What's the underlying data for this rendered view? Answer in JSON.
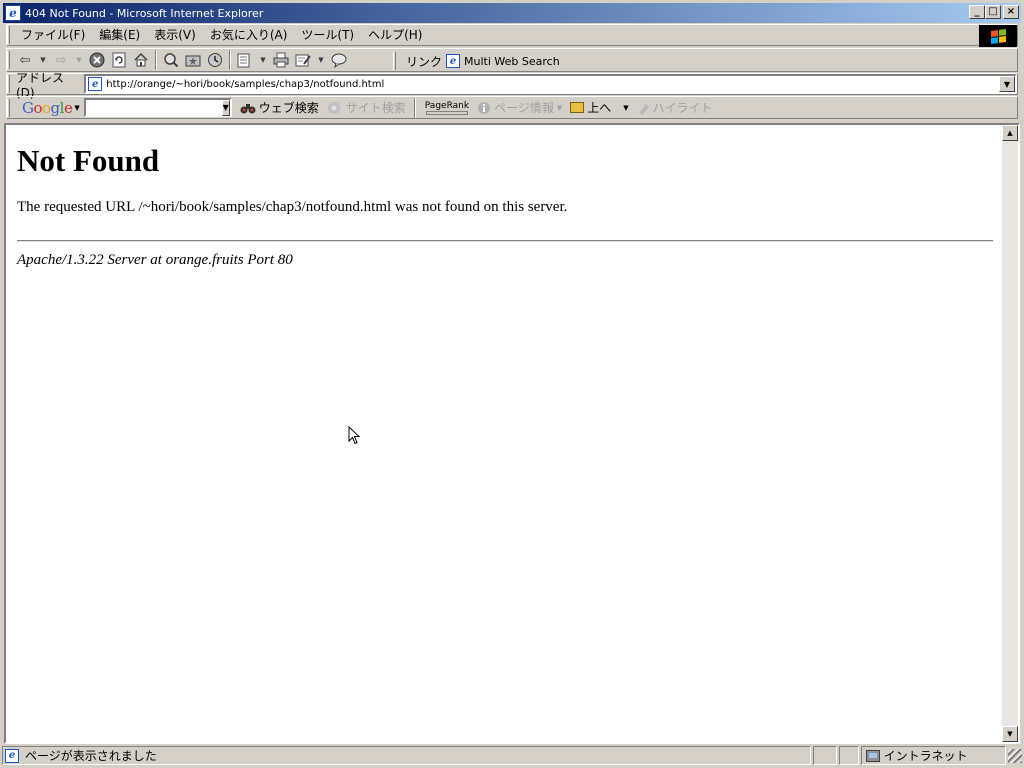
{
  "window": {
    "title": "404 Not Found - Microsoft Internet Explorer",
    "minimize": "_",
    "maximize": "□",
    "close": "×"
  },
  "menu": {
    "file": "ファイル(F)",
    "edit": "編集(E)",
    "view": "表示(V)",
    "favorites": "お気に入り(A)",
    "tools": "ツール(T)",
    "help": "ヘルプ(H)"
  },
  "toolbar": {
    "back": "⇦",
    "forward": "⇨",
    "links_label": "リンク",
    "link_multi_web_search": "Multi Web Search"
  },
  "address": {
    "label": "アドレス(D)",
    "url": "http://orange/~hori/book/samples/chap3/notfound.html"
  },
  "google": {
    "logo": {
      "G": "G",
      "o1": "o",
      "o2": "o",
      "g": "g",
      "l": "l",
      "e": "e"
    },
    "search_value": "",
    "web_search": "ウェブ検索",
    "site_search": "サイト検索",
    "pagerank": "PageRank",
    "page_info": "ページ情報",
    "up": "上へ",
    "highlight": "ハイライト"
  },
  "page": {
    "heading": "Not Found",
    "message": "The requested URL /~hori/book/samples/chap3/notfound.html was not found on this server.",
    "server_signature": "Apache/1.3.22 Server at orange.fruits Port 80"
  },
  "status": {
    "text": "ページが表示されました",
    "zone": "イントラネット"
  },
  "colors": {
    "title_gradient_start": "#0a246a",
    "title_gradient_end": "#a6caf0",
    "chrome": "#d4d0c8"
  }
}
